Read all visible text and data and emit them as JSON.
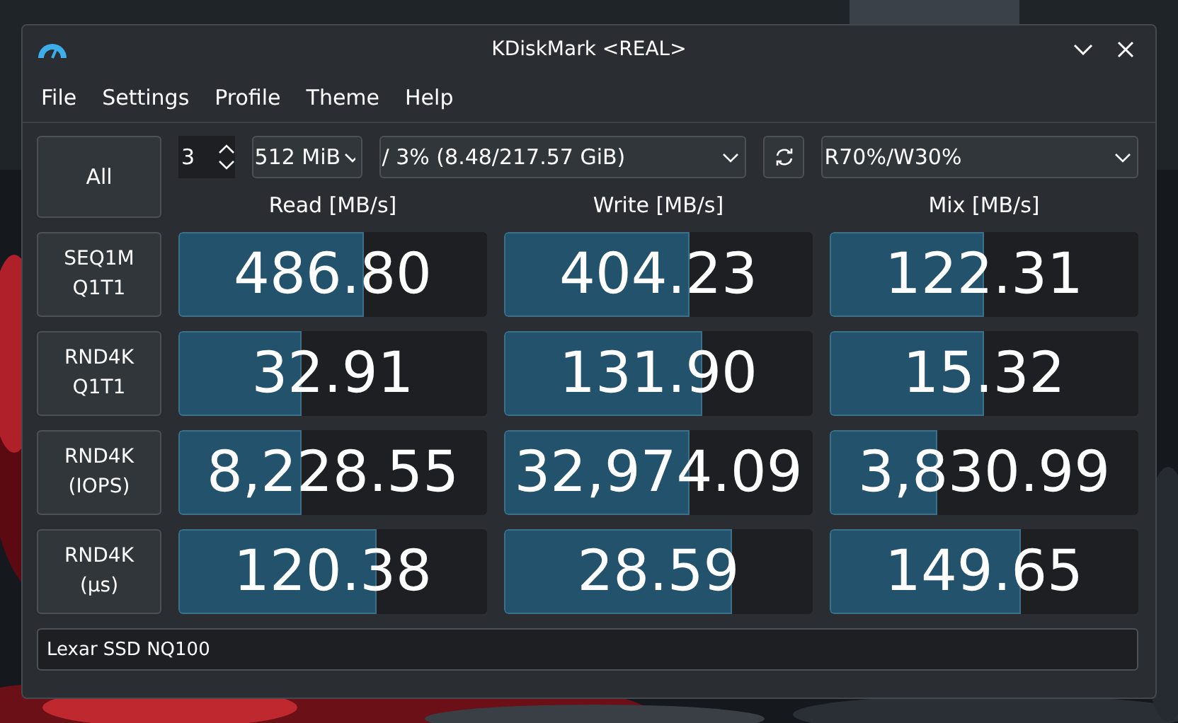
{
  "window": {
    "title": "KDiskMark <REAL>"
  },
  "menu": [
    "File",
    "Settings",
    "Profile",
    "Theme",
    "Help"
  ],
  "controls": {
    "all_button": "All",
    "loops": "3",
    "size": "512 MiB",
    "drive": "/ 3% (8.48/217.57 GiB)",
    "mix_mode": "R70%/W30%"
  },
  "columns": [
    "Read [MB/s]",
    "Write [MB/s]",
    "Mix [MB/s]"
  ],
  "rows": [
    {
      "label": "SEQ1M\nQ1T1",
      "results": [
        {
          "value": "486.80",
          "level": 0.6
        },
        {
          "value": "404.23",
          "level": 0.6
        },
        {
          "value": "122.31",
          "level": 0.5
        }
      ]
    },
    {
      "label": "RND4K\nQ1T1",
      "results": [
        {
          "value": "32.91",
          "level": 0.4
        },
        {
          "value": "131.90",
          "level": 0.64
        },
        {
          "value": "15.32",
          "level": 0.5
        }
      ]
    },
    {
      "label": "RND4K\n(IOPS)",
      "results": [
        {
          "value": "8,228.55",
          "level": 0.4
        },
        {
          "value": "32,974.09",
          "level": 0.6
        },
        {
          "value": "3,830.99",
          "level": 0.35
        }
      ]
    },
    {
      "label": "RND4K\n(µs)",
      "results": [
        {
          "value": "120.38",
          "level": 0.64
        },
        {
          "value": "28.59",
          "level": 0.74
        },
        {
          "value": "149.65",
          "level": 0.62
        }
      ]
    }
  ],
  "device": "Lexar SSD NQ100"
}
